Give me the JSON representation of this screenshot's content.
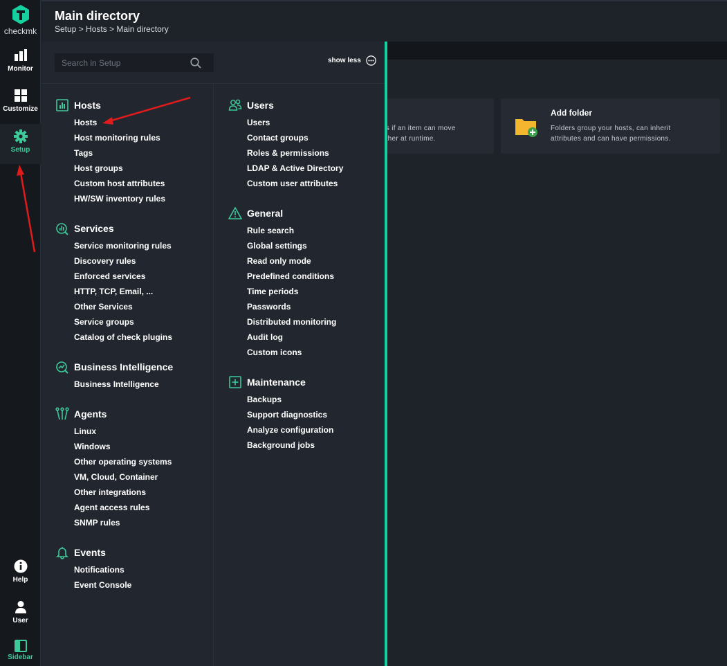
{
  "app": {
    "logo_text": "checkmk",
    "brand_color": "#15d1a0"
  },
  "nav": {
    "items": [
      {
        "label": "Monitor",
        "icon": "bar-chart-icon"
      },
      {
        "label": "Customize",
        "icon": "grid-icon"
      },
      {
        "label": "Setup",
        "icon": "gear-icon",
        "active": true
      },
      {
        "label": "Help",
        "icon": "info-icon"
      },
      {
        "label": "User",
        "icon": "user-icon"
      },
      {
        "label": "Sidebar",
        "icon": "sidebar-icon"
      }
    ]
  },
  "header": {
    "title": "Main directory",
    "breadcrumb": "Setup > Hosts > Main directory"
  },
  "page": {
    "cards": [
      {
        "title": "",
        "desc_line1": "sters if an item can move",
        "desc_line2": "another at runtime."
      },
      {
        "title": "Add folder",
        "desc_line1": "Folders group your hosts, can inherit",
        "desc_line2": "attributes and can have permissions.",
        "icon": "add-folder-icon"
      }
    ]
  },
  "menu": {
    "search_placeholder": "Search in Setup",
    "show_less": "show less",
    "topics": {
      "hosts": {
        "title": "Hosts",
        "items": [
          "Hosts",
          "Host monitoring rules",
          "Tags",
          "Host groups",
          "Custom host attributes",
          "HW/SW inventory rules"
        ]
      },
      "services": {
        "title": "Services",
        "items": [
          "Service monitoring rules",
          "Discovery rules",
          "Enforced services",
          "HTTP, TCP, Email, ...",
          "Other Services",
          "Service groups",
          "Catalog of check plugins"
        ]
      },
      "bi": {
        "title": "Business Intelligence",
        "items": [
          "Business Intelligence"
        ]
      },
      "agents": {
        "title": "Agents",
        "items": [
          "Linux",
          "Windows",
          "Other operating systems",
          "VM, Cloud, Container",
          "Other integrations",
          "Agent access rules",
          "SNMP rules"
        ]
      },
      "events": {
        "title": "Events",
        "items": [
          "Notifications",
          "Event Console"
        ]
      },
      "users": {
        "title": "Users",
        "items": [
          "Users",
          "Contact groups",
          "Roles & permissions",
          "LDAP & Active Directory",
          "Custom user attributes"
        ]
      },
      "general": {
        "title": "General",
        "items": [
          "Rule search",
          "Global settings",
          "Read only mode",
          "Predefined conditions",
          "Time periods",
          "Passwords",
          "Distributed monitoring",
          "Audit log",
          "Custom icons"
        ]
      },
      "maintenance": {
        "title": "Maintenance",
        "items": [
          "Backups",
          "Support diagnostics",
          "Analyze configuration",
          "Background jobs"
        ]
      }
    }
  }
}
